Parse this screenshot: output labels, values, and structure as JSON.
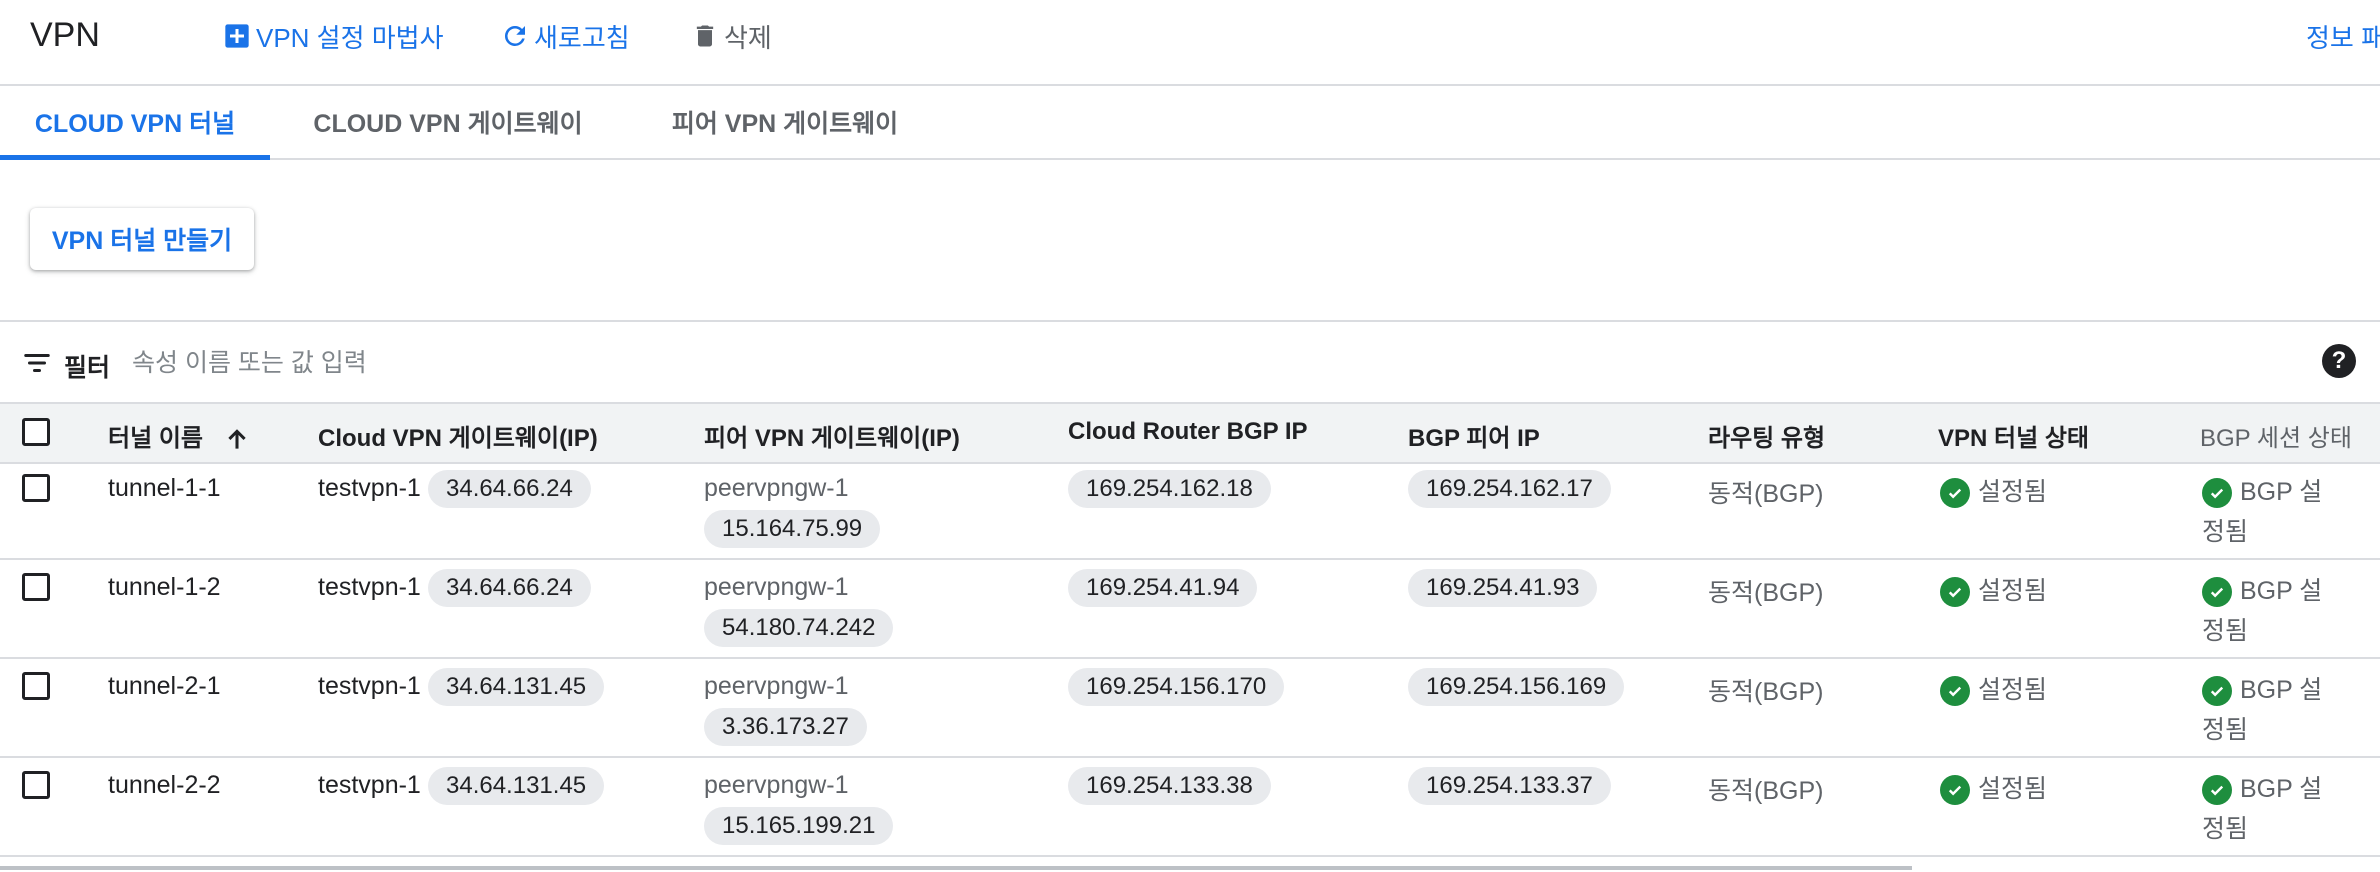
{
  "header": {
    "title": "VPN",
    "wizard_label": "VPN 설정 마법사",
    "refresh_label": "새로고침",
    "delete_label": "삭제",
    "info_panel_label": "정보 패"
  },
  "tabs": [
    {
      "label": "CLOUD VPN 터널",
      "active": true
    },
    {
      "label": "CLOUD VPN 게이트웨이",
      "active": false
    },
    {
      "label": "피어 VPN 게이트웨이",
      "active": false
    }
  ],
  "create_button_label": "VPN 터널 만들기",
  "filter": {
    "label": "필터",
    "placeholder": "속성 이름 또는 값 입력"
  },
  "table": {
    "columns": [
      "터널 이름",
      "Cloud VPN 게이트웨이(IP)",
      "피어 VPN 게이트웨이(IP)",
      "Cloud Router BGP IP",
      "BGP 피어 IP",
      "라우팅 유형",
      "VPN 터널 상태",
      "BGP 세션 상태"
    ],
    "rows": [
      {
        "name": "tunnel-1-1",
        "gw_name": "testvpn-1",
        "gw_ip": "34.64.66.24",
        "peer_name": "peervpngw-1",
        "peer_ip": "15.164.75.99",
        "router_ip": "169.254.162.18",
        "peer_bgp_ip": "169.254.162.17",
        "routing": "동적(BGP)",
        "tunnel_status": "설정됨",
        "bgp_status_1": "BGP 설",
        "bgp_status_2": "정됨"
      },
      {
        "name": "tunnel-1-2",
        "gw_name": "testvpn-1",
        "gw_ip": "34.64.66.24",
        "peer_name": "peervpngw-1",
        "peer_ip": "54.180.74.242",
        "router_ip": "169.254.41.94",
        "peer_bgp_ip": "169.254.41.93",
        "routing": "동적(BGP)",
        "tunnel_status": "설정됨",
        "bgp_status_1": "BGP 설",
        "bgp_status_2": "정됨"
      },
      {
        "name": "tunnel-2-1",
        "gw_name": "testvpn-1",
        "gw_ip": "34.64.131.45",
        "peer_name": "peervpngw-1",
        "peer_ip": "3.36.173.27",
        "router_ip": "169.254.156.170",
        "peer_bgp_ip": "169.254.156.169",
        "routing": "동적(BGP)",
        "tunnel_status": "설정됨",
        "bgp_status_1": "BGP 설",
        "bgp_status_2": "정됨"
      },
      {
        "name": "tunnel-2-2",
        "gw_name": "testvpn-1",
        "gw_ip": "34.64.131.45",
        "peer_name": "peervpngw-1",
        "peer_ip": "15.165.199.21",
        "router_ip": "169.254.133.38",
        "peer_bgp_ip": "169.254.133.37",
        "routing": "동적(BGP)",
        "tunnel_status": "설정됨",
        "bgp_status_1": "BGP 설",
        "bgp_status_2": "정됨"
      }
    ]
  },
  "colors": {
    "accent": "#1a73e8",
    "success": "#1e8e3e",
    "chip_bg": "#e8eaed"
  }
}
